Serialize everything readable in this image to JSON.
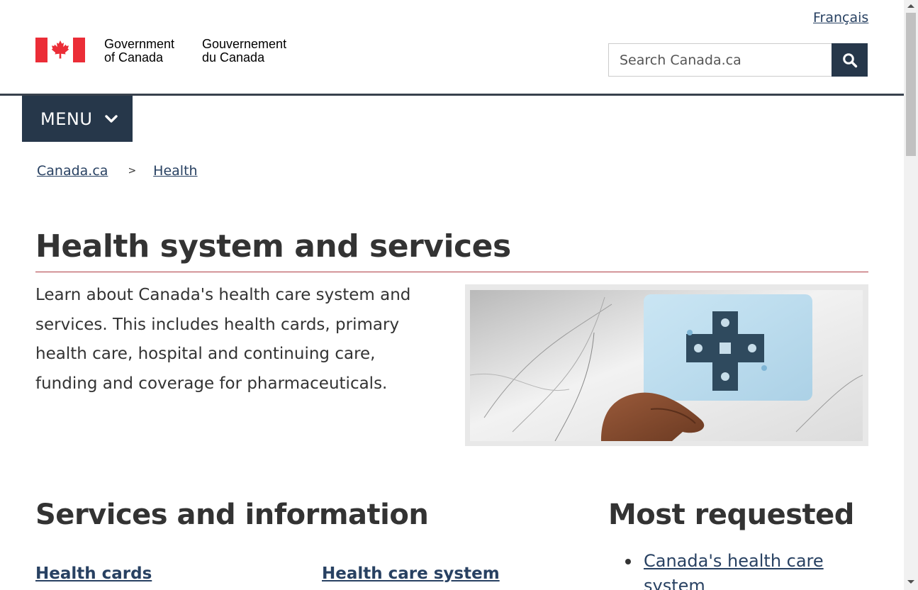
{
  "header": {
    "language_link": "Français",
    "wordmark_en": "Government\nof Canada",
    "wordmark_fr": "Gouvernement\ndu Canada",
    "search_placeholder": "Search Canada.ca",
    "menu_label": "MENU"
  },
  "breadcrumb": {
    "items": [
      "Canada.ca",
      "Health"
    ],
    "separator": ">"
  },
  "main": {
    "title": "Health system and services",
    "intro": "Learn about Canada's health care system and services. This includes health cards, primary health care, hospital and continuing care, funding and coverage for pharmaceuticals.",
    "services_heading": "Services and information",
    "services": [
      "Health cards",
      "Health care system"
    ],
    "most_requested_heading": "Most requested",
    "most_requested": [
      "Canada's health care system"
    ]
  },
  "colors": {
    "header_navy": "#26374a",
    "link": "#284162",
    "title_rule": "#af3c43",
    "flag_red": "#eb2d37"
  },
  "icons": {
    "search": "search-icon",
    "menu": "chevron-down-icon",
    "flag": "canada-flag-icon"
  }
}
